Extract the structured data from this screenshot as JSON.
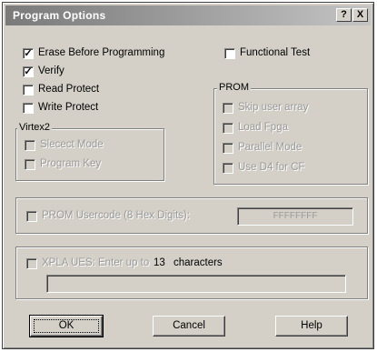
{
  "window": {
    "title": "Program Options",
    "help_button": "?",
    "close_button": "X"
  },
  "options": {
    "erase_before_programming": {
      "label": "Erase Before Programming",
      "checked": true
    },
    "verify": {
      "label": "Verify",
      "checked": true
    },
    "read_protect": {
      "label": "Read Protect",
      "checked": false
    },
    "write_protect": {
      "label": "Write Protect",
      "checked": false
    },
    "functional_test": {
      "label": "Functional Test",
      "checked": false
    }
  },
  "virtex2": {
    "title": "Virtex2",
    "items": [
      {
        "label": "Slecect Mode",
        "checked": false
      },
      {
        "label": "Program Key",
        "checked": false
      }
    ]
  },
  "prom": {
    "title": "PROM",
    "items": [
      {
        "label": "Skip user array",
        "checked": false
      },
      {
        "label": "Load Fpga",
        "checked": false
      },
      {
        "label": "Parallel Mode",
        "checked": false
      },
      {
        "label": "Use D4 for CF",
        "checked": false
      }
    ]
  },
  "usercode": {
    "label": "PROM Usercode (8 Hex Digits):",
    "value": "FFFFFFFF",
    "checked": false
  },
  "xpla": {
    "label": "XPLA UES: Enter up to",
    "count": "13",
    "suffix": "characters",
    "value": "",
    "checked": false
  },
  "buttons": {
    "ok": "OK",
    "cancel": "Cancel",
    "help": "Help"
  }
}
